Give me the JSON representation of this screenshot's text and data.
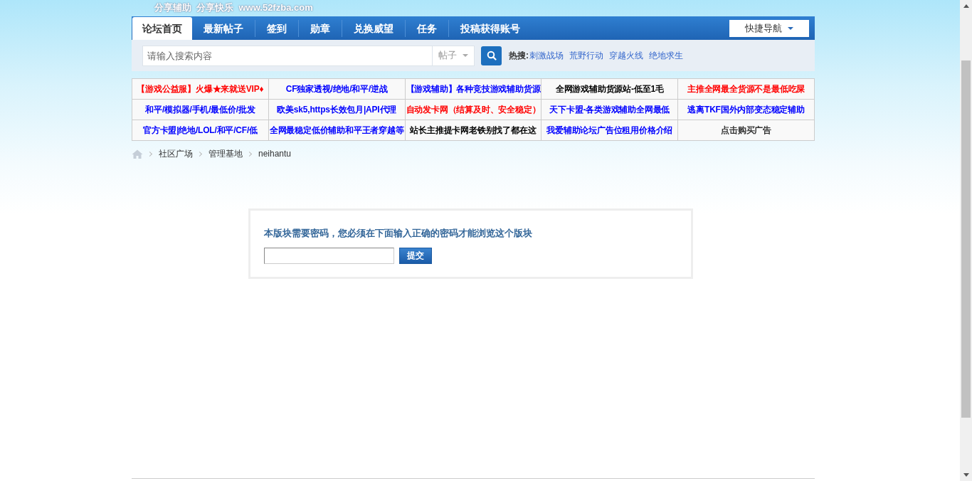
{
  "header": {
    "slogan": "分享辅助  分享快乐  www.52fzba.com"
  },
  "nav": {
    "tabs": [
      {
        "label": "论坛首页",
        "selected": true
      },
      {
        "label": "最新帖子",
        "selected": false
      },
      {
        "label": "签到",
        "selected": false
      },
      {
        "label": "勋章",
        "selected": false
      },
      {
        "label": "兑换威望",
        "selected": false
      },
      {
        "label": "任务",
        "selected": false
      },
      {
        "label": "投稿获得账号",
        "selected": false
      }
    ],
    "quick_nav": "快捷导航"
  },
  "search": {
    "placeholder": "请输入搜索内容",
    "scope": "帖子",
    "hot_label": "热搜:",
    "hot_terms": [
      "刺激战场",
      "荒野行动",
      "穿越火线",
      "绝地求生"
    ]
  },
  "ads": [
    {
      "text": "【游戏公益服】火爆★来就送VIP♦",
      "color": "#ff0000"
    },
    {
      "text": "CF独家透视/绝地/和平/逆战",
      "color": "#0000ff"
    },
    {
      "text": "【游戏辅助】各种竞技游戏辅助货源",
      "color": "#0000ff"
    },
    {
      "text": "全网游戏辅助货源站-低至1毛",
      "color": "#000000"
    },
    {
      "text": "主推全网最全货源不是最低吃屎",
      "color": "#ff0000"
    },
    {
      "text": "和平/模拟器/手机/最低价/批发",
      "color": "#0000ff"
    },
    {
      "text": "欧美sk5,https长效包月|API代理",
      "color": "#0000ff"
    },
    {
      "text": "自动发卡网（结算及时、安全稳定）",
      "color": "#ff0000"
    },
    {
      "text": "天下卡盟-各类游戏辅助全网最低",
      "color": "#0000ff"
    },
    {
      "text": "逃离TKF国外内部变态稳定辅助",
      "color": "#0000ff"
    },
    {
      "text": "官方卡盟|绝地/LOL/和平/CF/低",
      "color": "#0000ff"
    },
    {
      "text": "全网最稳定低价辅助和平王者穿越等",
      "color": "#0000ff"
    },
    {
      "text": "站长主推提卡网老铁别找了都在这",
      "color": "#000000"
    },
    {
      "text": "我爱辅助论坛广告位租用价格介绍",
      "color": "#0000ff"
    },
    {
      "text": "点击购买广告",
      "color": "#333333"
    }
  ],
  "breadcrumb": [
    "社区广场",
    "管理基地",
    "neihantu"
  ],
  "password_box": {
    "message": "本版块需要密码，您必须在下面输入正确的密码才能浏览这个版块",
    "submit": "提交"
  }
}
